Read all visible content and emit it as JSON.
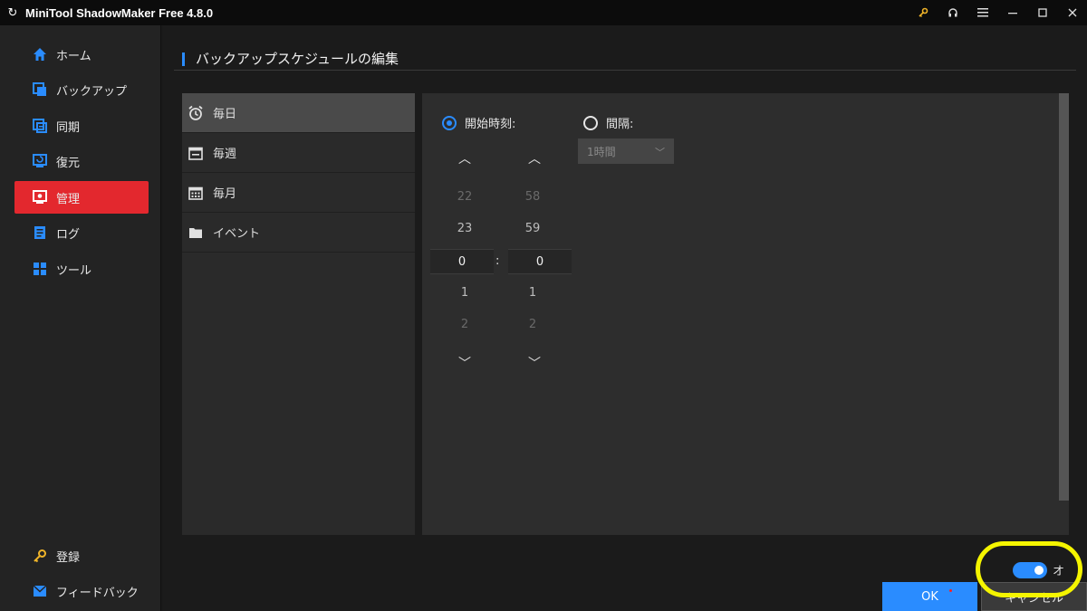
{
  "app": {
    "title": "MiniTool ShadowMaker Free 4.8.0"
  },
  "window_controls": [
    "key-icon",
    "headset-icon",
    "menu-icon",
    "minimize-icon",
    "maximize-icon",
    "close-icon"
  ],
  "sidebar": {
    "items": [
      {
        "label": "ホーム",
        "icon": "home-icon"
      },
      {
        "label": "バックアップ",
        "icon": "backup-icon"
      },
      {
        "label": "同期",
        "icon": "sync-icon"
      },
      {
        "label": "復元",
        "icon": "restore-icon"
      },
      {
        "label": "管理",
        "icon": "manage-icon",
        "active": true
      },
      {
        "label": "ログ",
        "icon": "log-icon"
      },
      {
        "label": "ツール",
        "icon": "tools-icon"
      }
    ],
    "bottom": [
      {
        "label": "登録",
        "icon": "key-icon"
      },
      {
        "label": "フィードバック",
        "icon": "mail-icon"
      }
    ]
  },
  "page": {
    "title": "バックアップスケジュールの編集"
  },
  "frequency": {
    "items": [
      {
        "label": "毎日",
        "icon": "alarm-clock-icon",
        "selected": true
      },
      {
        "label": "毎週",
        "icon": "calendar-week-icon"
      },
      {
        "label": "毎月",
        "icon": "calendar-month-icon"
      },
      {
        "label": "イベント",
        "icon": "folder-icon"
      }
    ]
  },
  "schedule": {
    "start_time_label": "開始時刻:",
    "interval_label": "間隔:",
    "interval_value": "1時間",
    "hours": {
      "prev2": "22",
      "prev1": "23",
      "current": "0",
      "next1": "1",
      "next2": "2"
    },
    "minutes": {
      "prev2": "58",
      "prev1": "59",
      "current": "0",
      "next1": "1",
      "next2": "2"
    },
    "separator": ":",
    "up_glyph": "︿",
    "down_glyph": "﹀"
  },
  "footer": {
    "toggle_label": "オ",
    "ok_label": "OK",
    "cancel_label": "キャンセル"
  },
  "colors": {
    "accent": "#2a8cff",
    "active_nav": "#e3282e",
    "highlight": "#f5f500"
  }
}
